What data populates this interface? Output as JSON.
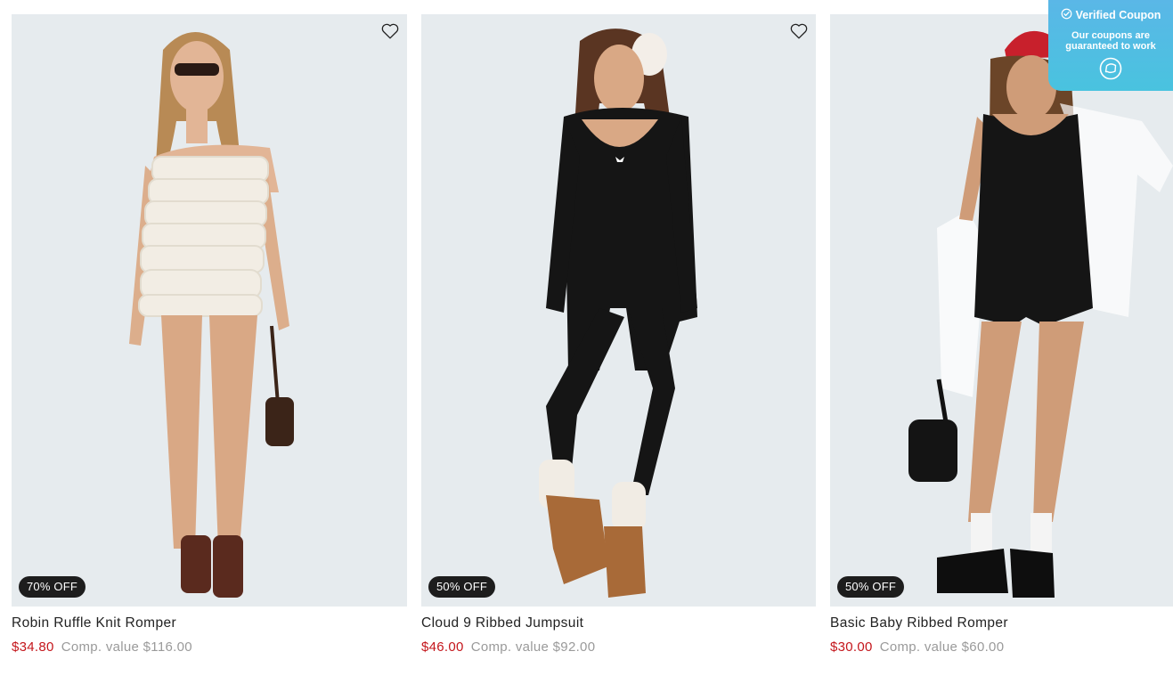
{
  "products": [
    {
      "name": "Robin Ruffle Knit Romper",
      "price": "$34.80",
      "comp_value": "Comp. value $116.00",
      "badge": "70% OFF",
      "outfit_color": "#f2ede4"
    },
    {
      "name": "Cloud 9 Ribbed Jumpsuit",
      "price": "$46.00",
      "comp_value": "Comp. value $92.00",
      "badge": "50% OFF",
      "outfit_color": "#151515"
    },
    {
      "name": "Basic Baby Ribbed Romper",
      "price": "$30.00",
      "comp_value": "Comp. value $60.00",
      "badge": "50% OFF",
      "outfit_color": "#151515"
    }
  ],
  "coupon_widget": {
    "title": "Verified Coupon",
    "subtitle": "Our coupons are guaranteed to work",
    "icon": "chat-bubble-icon"
  },
  "colors": {
    "price_red": "#c4161c",
    "comp_gray": "#9a9a9a",
    "badge_bg": "#1d1d1d",
    "image_bg": "#e6ebee",
    "coupon_bg": "#52bde3"
  }
}
